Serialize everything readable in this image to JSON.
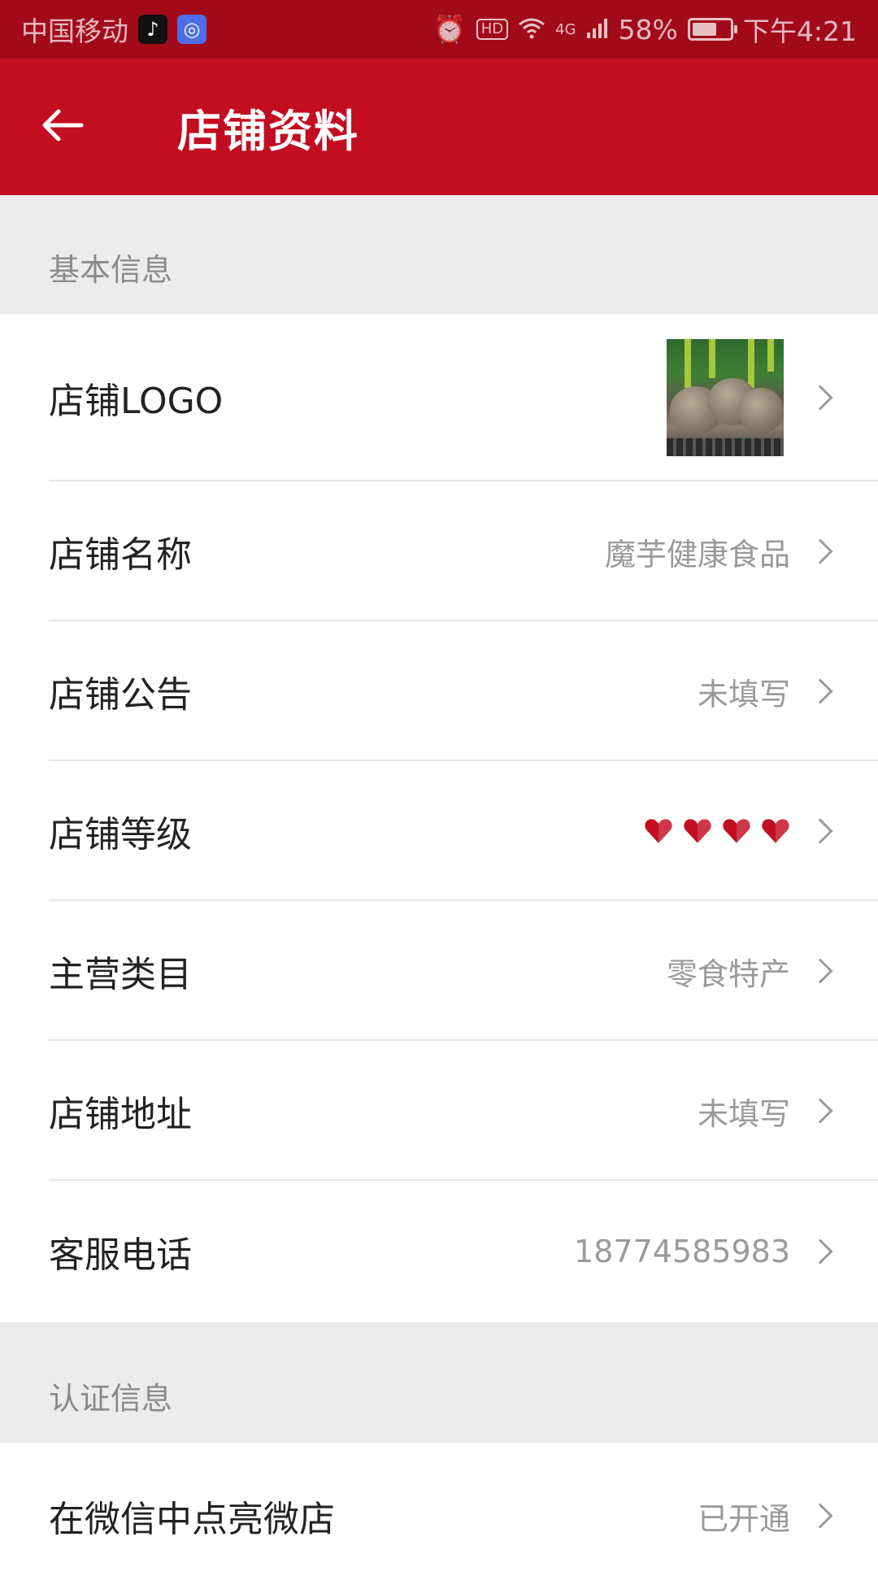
{
  "status_bar": {
    "carrier": "中国移动",
    "network": "4G",
    "battery_percent": "58%",
    "battery_level": 0.58,
    "time": "下午4:21",
    "icons": [
      "tiktok-icon",
      "browser-icon",
      "alarm-icon",
      "hd-icon",
      "wifi-icon",
      "signal-icon",
      "battery-icon"
    ]
  },
  "header": {
    "title": "店铺资料",
    "back_icon": "back-arrow-icon",
    "background_color": "#c30d20"
  },
  "sections": {
    "basic": {
      "title": "基本信息",
      "rows": {
        "logo": {
          "label": "店铺LOGO"
        },
        "name": {
          "label": "店铺名称",
          "value": "魔芋健康食品"
        },
        "notice": {
          "label": "店铺公告",
          "value": "未填写"
        },
        "level": {
          "label": "店铺等级",
          "hearts": 4,
          "heart_color": "#c30d20"
        },
        "category": {
          "label": "主营类目",
          "value": "零食特产"
        },
        "address": {
          "label": "店铺地址",
          "value": "未填写"
        },
        "phone": {
          "label": "客服电话",
          "value": "18774585983"
        }
      }
    },
    "certification": {
      "title": "认证信息",
      "rows": {
        "wechat": {
          "label": "在微信中点亮微店",
          "value": "已开通"
        }
      }
    }
  }
}
